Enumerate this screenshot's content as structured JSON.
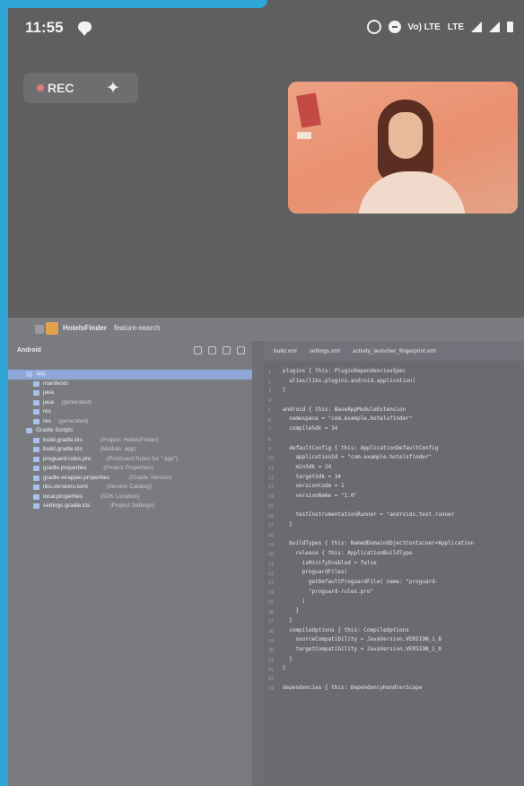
{
  "status_bar": {
    "time": "11:55",
    "carrier": "Vo) LTE",
    "network": "LTE",
    "icons": [
      "message-icon",
      "alarm-icon",
      "data-saver-icon",
      "signal-icon",
      "signal-icon",
      "battery-icon"
    ]
  },
  "recording": {
    "label": "REC",
    "sparkle_icon": "sparkle-icon"
  },
  "ide": {
    "project_name": "HotelsFinder",
    "branch": "feature-search",
    "panel_title": "Android",
    "tabs": [
      "build.xml",
      "settings.xml",
      "activity_launcher_fingerprint.xml"
    ],
    "tree": [
      {
        "label": "app",
        "hint": "",
        "indent": 8,
        "selected": true
      },
      {
        "label": "manifests",
        "hint": "",
        "indent": 16
      },
      {
        "label": "java",
        "hint": "",
        "indent": 16
      },
      {
        "label": "java",
        "hint": "(generated)",
        "indent": 16
      },
      {
        "label": "res",
        "hint": "",
        "indent": 16
      },
      {
        "label": "res",
        "hint": "(generated)",
        "indent": 16
      },
      {
        "label": "Gradle Scripts",
        "hint": "",
        "indent": 8
      },
      {
        "label": "build.gradle.kts",
        "hint": "(Project: HotelsFinder)",
        "indent": 16
      },
      {
        "label": "build.gradle.kts",
        "hint": "(Module: app)",
        "indent": 16
      },
      {
        "label": "proguard-rules.pro",
        "hint": "(ProGuard Rules for \":app\")",
        "indent": 16
      },
      {
        "label": "gradle.properties",
        "hint": "(Project Properties)",
        "indent": 16
      },
      {
        "label": "gradle-wrapper.properties",
        "hint": "(Gradle Version)",
        "indent": 16
      },
      {
        "label": "libs.versions.toml",
        "hint": "(Version Catalog)",
        "indent": 16
      },
      {
        "label": "local.properties",
        "hint": "(SDK Location)",
        "indent": 16
      },
      {
        "label": "settings.gradle.kts",
        "hint": "(Project Settings)",
        "indent": 16
      }
    ],
    "code_lines": [
      {
        "n": "1",
        "text": "plugins { this: PluginDependenciesSpec"
      },
      {
        "n": "2",
        "text": "  alias(libs.plugins.android.application)"
      },
      {
        "n": "3",
        "text": "}"
      },
      {
        "n": "4",
        "text": ""
      },
      {
        "n": "5",
        "text": "android { this: BaseAppModuleExtension"
      },
      {
        "n": "6",
        "text": "  namespace = \"com.example.hotelsfinder\""
      },
      {
        "n": "7",
        "text": "  compileSdk = 34"
      },
      {
        "n": "8",
        "text": ""
      },
      {
        "n": "9",
        "text": "  defaultConfig { this: ApplicationDefaultConfig"
      },
      {
        "n": "10",
        "text": "    applicationId = \"com.example.hotelsfinder\""
      },
      {
        "n": "11",
        "text": "    minSdk = 24"
      },
      {
        "n": "12",
        "text": "    targetSdk = 34"
      },
      {
        "n": "13",
        "text": "    versionCode = 1"
      },
      {
        "n": "14",
        "text": "    versionName = \"1.0\""
      },
      {
        "n": "15",
        "text": ""
      },
      {
        "n": "16",
        "text": "    testInstrumentationRunner = \"androidx.test.runner"
      },
      {
        "n": "17",
        "text": "  }"
      },
      {
        "n": "18",
        "text": ""
      },
      {
        "n": "19",
        "text": "  buildTypes { this: NamedDomainObjectContainer<Application"
      },
      {
        "n": "20",
        "text": "    release { this: ApplicationBuildType"
      },
      {
        "n": "21",
        "text": "      isMinifyEnabled = false"
      },
      {
        "n": "22",
        "text": "      proguardFiles("
      },
      {
        "n": "23",
        "text": "        getDefaultProguardFile( name: \"proguard-"
      },
      {
        "n": "24",
        "text": "        \"proguard-rules.pro\""
      },
      {
        "n": "25",
        "text": "      )"
      },
      {
        "n": "26",
        "text": "    }"
      },
      {
        "n": "27",
        "text": "  }"
      },
      {
        "n": "28",
        "text": "  compileOptions { this: CompileOptions"
      },
      {
        "n": "29",
        "text": "    sourceCompatibility = JavaVersion.VERSION_1_8"
      },
      {
        "n": "30",
        "text": "    targetCompatibility = JavaVersion.VERSION_1_8"
      },
      {
        "n": "31",
        "text": "  }"
      },
      {
        "n": "32",
        "text": "}"
      },
      {
        "n": "33",
        "text": ""
      },
      {
        "n": "34",
        "text": "dependencies { this: DependencyHandlerScope"
      }
    ]
  },
  "colors": {
    "frame": "#2ea6d6",
    "rec_dot": "#e07a80",
    "selection": "#8fa6d8"
  }
}
